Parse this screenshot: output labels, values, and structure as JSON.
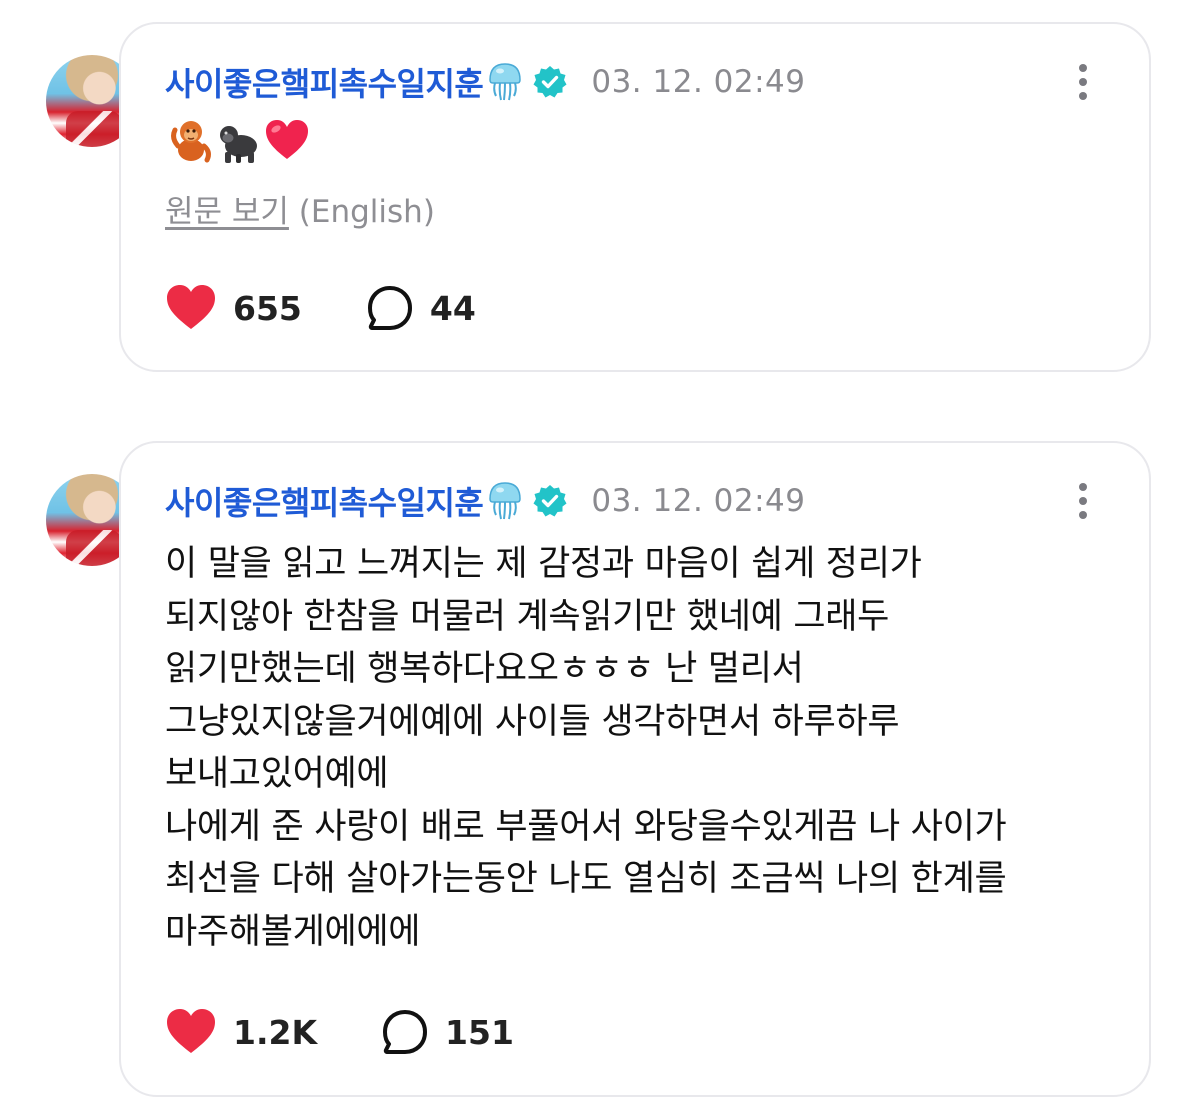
{
  "posts": [
    {
      "author": "사이좋은햌피촉수일지훈",
      "author_icons": [
        "jellyfish-emoji",
        "verified-check-icon"
      ],
      "timestamp": "03. 12. 02:49",
      "emojis": [
        "orangutan-emoji",
        "gorilla-emoji",
        "red-heart-emoji"
      ],
      "translate_link": "원문 보기",
      "translate_lang": "(English)",
      "likes": "655",
      "comments": "44"
    },
    {
      "author": "사이좋은햌피촉수일지훈",
      "author_icons": [
        "jellyfish-emoji",
        "verified-check-icon"
      ],
      "timestamp": "03. 12. 02:49",
      "lines": [
        "이 말을 읽고 느껴지는 제 감정과 마음이 쉽게 정리가",
        "되지않아 한참을 머물러 계속읽기만 했네예 그래두",
        "읽기만했는데 행복하다요오ㅎㅎㅎ 난 멀리서",
        "그냥있지않을거에예에 사이들 생각하면서 하루하루",
        "보내고있어예에",
        "나에게 준 사랑이 배로 부풀어서 와당을수있게끔 나 사이가",
        "최선을 다해 살아가는동안 나도 열심히 조금씩 나의 한계를",
        "마주해볼게에에에"
      ],
      "likes": "1.2K",
      "comments": "151"
    }
  ],
  "colors": {
    "author": "#1f5bd6",
    "verified": "#22c3c8",
    "heart": "#ec2c45",
    "timestamp": "#8a8a8f"
  }
}
